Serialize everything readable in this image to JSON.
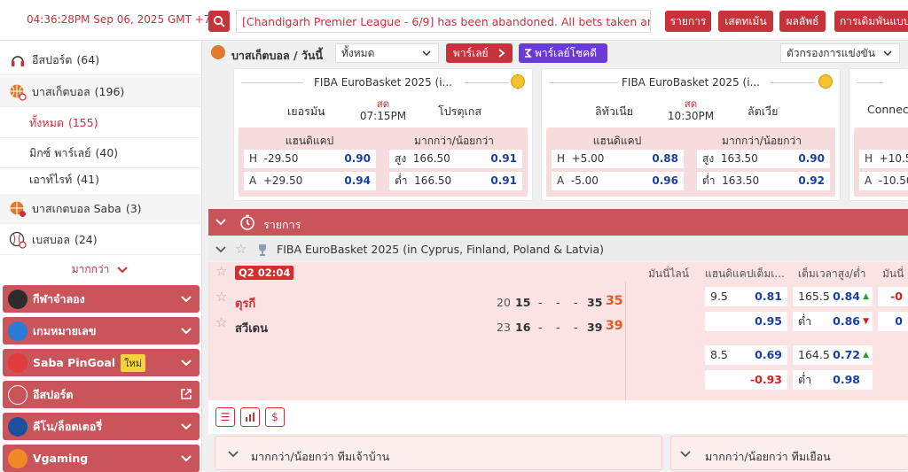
{
  "topbar": {
    "clock": "04:36:28PM Sep 06, 2025 GMT +7",
    "ticker": "[Chandigarh Premier League - 6/9] has been abandoned. All bets taken are",
    "buttons": [
      "รายการ",
      "เสตทเม้น",
      "ผลลัพธ์",
      "การเดิมพันแบบ"
    ]
  },
  "sidebar": {
    "items": [
      {
        "label": "อีสปอร์ต",
        "count": "(64)"
      },
      {
        "label": "บาสเก็ตบอล",
        "count": "(196)"
      },
      {
        "label": "ทั้งหมด",
        "count": "(155)"
      },
      {
        "label": "มิกซ์ พาร์เลย์",
        "count": "(40)"
      },
      {
        "label": "เอาท์ไรท์",
        "count": "(41)"
      },
      {
        "label": "บาสเกตบอล Saba",
        "count": "(3)"
      },
      {
        "label": "เบสบอล",
        "count": "(24)"
      }
    ],
    "more": "มากกว่า",
    "sections": [
      {
        "label": "กีฬาจำลอง"
      },
      {
        "label": "เกมหมายเลข"
      },
      {
        "label": "Saba PinGoal",
        "badge": "ใหม่"
      },
      {
        "label": "อีสปอร์ต"
      },
      {
        "label": "คีโน/ล็อตเตอรี่"
      },
      {
        "label": "Vgaming"
      }
    ]
  },
  "filter": {
    "title": "บาสเก็ตบอล / วันนี้",
    "select": "ทั้งหมด",
    "parlay": "พาร์เลย์",
    "parlay_pro": "พาร์เลย์โชคดี",
    "competition_filter": "ตัวกรองการแข่งขัน"
  },
  "cards": [
    {
      "league": "FIBA EuroBasket 2025 (i...",
      "home": "เยอรมัน",
      "away": "โปรตุเกส",
      "status": "สด",
      "time": "07:15PM",
      "hdp_label": "แฮนดิแคป",
      "ou_label": "มากกว่า/น้อยกว่า",
      "hdp": [
        {
          "side": "H",
          "line": "-29.50",
          "odds": "0.90"
        },
        {
          "side": "A",
          "line": "+29.50",
          "odds": "0.94"
        }
      ],
      "ou": [
        {
          "side": "สูง",
          "line": "166.50",
          "odds": "0.91"
        },
        {
          "side": "ต่ำ",
          "line": "166.50",
          "odds": "0.91"
        }
      ]
    },
    {
      "league": "FIBA EuroBasket 2025 (i...",
      "home": "ลิทัวเนีย",
      "away": "ลัตเวีย",
      "status": "สด",
      "time": "10:30PM",
      "hdp_label": "แฮนดิแคป",
      "ou_label": "มากกว่า/น้อยกว่า",
      "hdp": [
        {
          "side": "H",
          "line": "+5.00",
          "odds": "0.88"
        },
        {
          "side": "A",
          "line": "-5.00",
          "odds": "0.96"
        }
      ],
      "ou": [
        {
          "side": "สูง",
          "line": "163.50",
          "odds": "0.90"
        },
        {
          "side": "ต่ำ",
          "line": "163.50",
          "odds": "0.92"
        }
      ]
    },
    {
      "league": "Connec",
      "hdp_partial": [
        {
          "side": "H",
          "line": "+10.5"
        },
        {
          "side": "A",
          "line": "-10.50"
        }
      ]
    }
  ],
  "section": {
    "title": "รายการ"
  },
  "league": {
    "name": "FIBA EuroBasket 2025 (in Cyprus, Finland, Poland & Latvia)"
  },
  "match_header": {
    "col1": "มันนี่ไลน์",
    "col2": "แฮนดิแคปเต็มเ...",
    "col3": "เต็มเวลาสูง/ต่ำ",
    "col4": "มันนี่"
  },
  "match": {
    "period": "Q2",
    "clock": "02:04",
    "home": {
      "name": "ตุรกี",
      "q1": "20",
      "q2": "15",
      "q3": "-",
      "q4": "-",
      "ot": "-",
      "ht": "35",
      "total": "35"
    },
    "away": {
      "name": "สวีเดน",
      "q1": "23",
      "q2": "16",
      "q3": "-",
      "q4": "-",
      "ot": "-",
      "ht": "39",
      "total": "39"
    },
    "rows": [
      {
        "hdp_line": "9.5",
        "hdp_odds_home": "0.81",
        "hdp_odds_away": "0.95",
        "ou_line": "165.5",
        "ou_over": "0.84",
        "ou_under_label": "ต่ำ",
        "ou_under": "0.86",
        "right_partial_1": "-0",
        "right_partial_2": "0"
      },
      {
        "hdp_line": "8.5",
        "hdp_odds_home": "0.69",
        "hdp_odds_away": "-0.93",
        "ou_line": "164.5",
        "ou_over": "0.72",
        "ou_under_label": "ต่ำ",
        "ou_under": "0.98"
      }
    ]
  },
  "panels": [
    {
      "title": "มากกว่า/น้อยกว่า ทีมเจ้าบ้าน"
    },
    {
      "title": "มากกว่า/น้อยกว่า ทีมเยือน"
    }
  ]
}
